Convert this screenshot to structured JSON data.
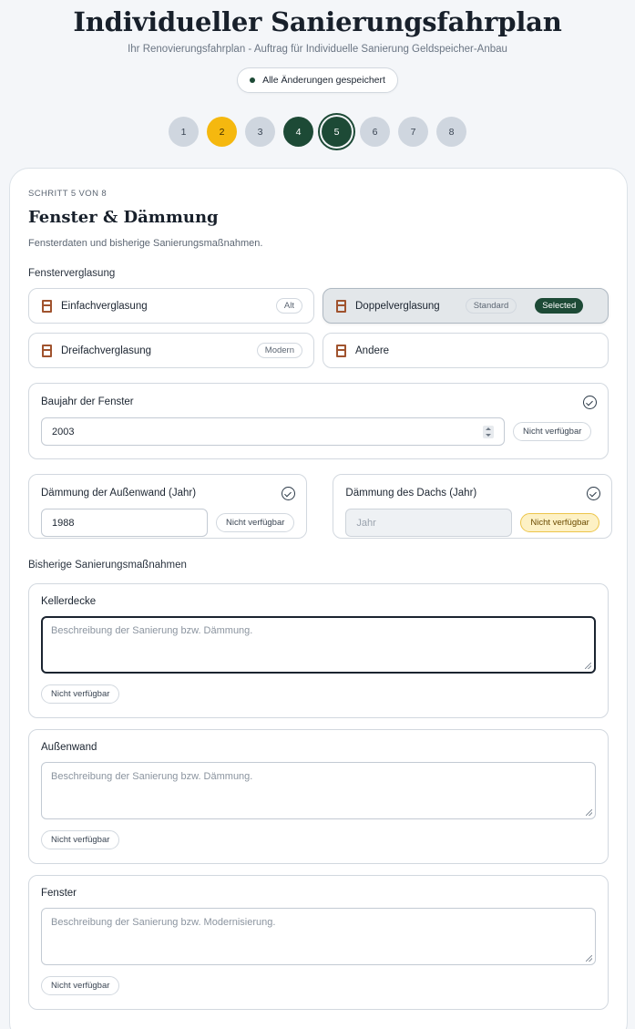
{
  "header": {
    "title": "Individueller Sanierungsfahrplan",
    "subtitle": "Ihr Renovierungsfahrplan - Auftrag für Individuelle Sanierung Geldspeicher-Anbau",
    "saved_status": "Alle Änderungen gespeichert"
  },
  "steps": [
    "1",
    "2",
    "3",
    "4",
    "5",
    "6",
    "7",
    "8"
  ],
  "card": {
    "step_label": "SCHRITT 5 VON 8",
    "title": "Fenster & Dämmung",
    "description": "Fensterdaten und bisherige Sanierungsmaßnahmen."
  },
  "glazing": {
    "label": "Fensterverglasung",
    "options": [
      {
        "label": "Einfachverglasung",
        "tag": "Alt"
      },
      {
        "label": "Doppelverglasung",
        "tag": "Standard",
        "selected_badge": "Selected"
      },
      {
        "label": "Dreifachverglasung",
        "tag": "Modern"
      },
      {
        "label": "Andere"
      }
    ]
  },
  "window_year": {
    "label": "Baujahr der Fenster",
    "value": "2003",
    "na_label": "Nicht verfügbar"
  },
  "wall_insulation": {
    "label": "Dämmung der Außenwand (Jahr)",
    "value": "1988",
    "na_label": "Nicht verfügbar"
  },
  "roof_insulation": {
    "label": "Dämmung des Dachs (Jahr)",
    "placeholder": "Jahr",
    "na_label": "Nicht verfügbar"
  },
  "measures": {
    "label": "Bisherige Sanierungsmaßnahmen",
    "items": [
      {
        "label": "Kellerdecke",
        "placeholder": "Beschreibung der Sanierung bzw. Dämmung.",
        "na_label": "Nicht verfügbar"
      },
      {
        "label": "Außenwand",
        "placeholder": "Beschreibung der Sanierung bzw. Dämmung.",
        "na_label": "Nicht verfügbar"
      },
      {
        "label": "Fenster",
        "placeholder": "Beschreibung der Sanierung bzw. Modernisierung.",
        "na_label": "Nicht verfügbar"
      }
    ]
  },
  "colors": {
    "primary": "#1d4a36",
    "warning": "#f5b80f",
    "step_inactive": "#cfd6df",
    "window_icon": "#a0532e"
  }
}
